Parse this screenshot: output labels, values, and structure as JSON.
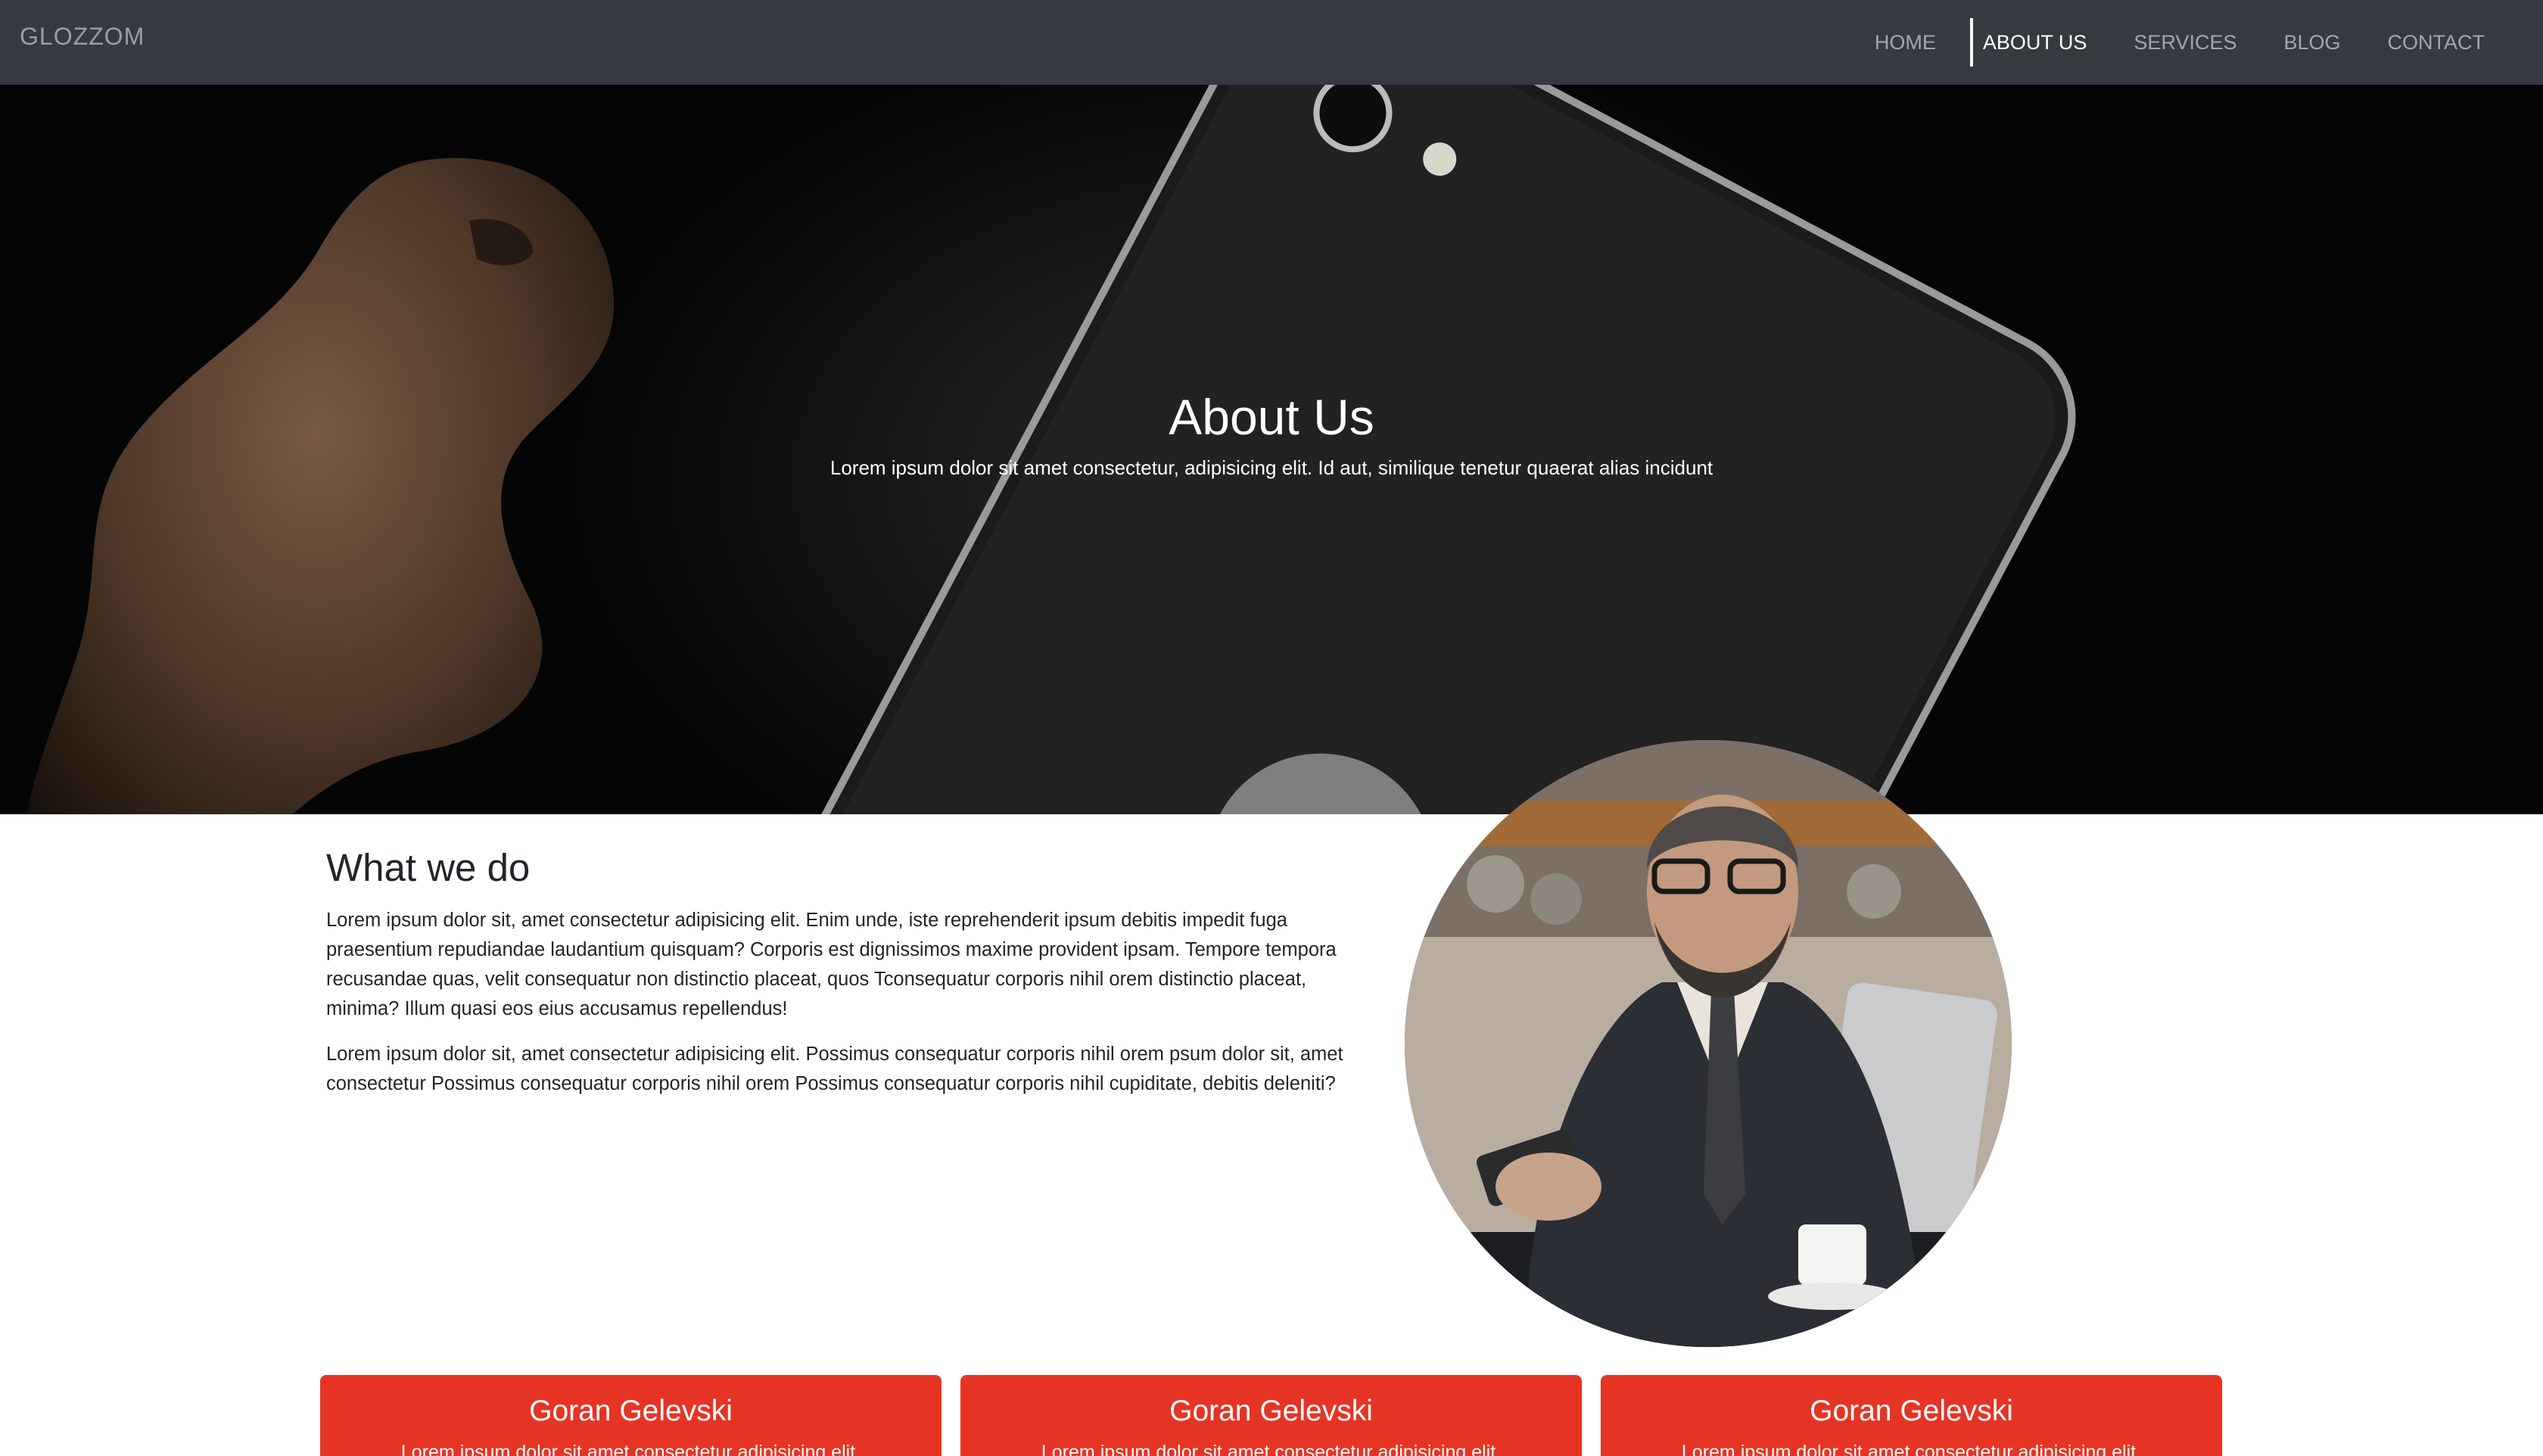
{
  "navbar": {
    "brand": "GLOZZOM",
    "links": [
      {
        "label": "HOME"
      },
      {
        "label": "ABOUT US",
        "active": true
      },
      {
        "label": "SERVICES"
      },
      {
        "label": "BLOG"
      },
      {
        "label": "CONTACT"
      }
    ]
  },
  "hero": {
    "title": "About Us",
    "subtitle": "Lorem ipsum dolor sit amet consectetur, adipisicing elit. Id aut, similique tenetur quaerat alias incidunt"
  },
  "about": {
    "title": "What we do",
    "paragraphs": [
      "Lorem ipsum dolor sit, amet consectetur adipisicing elit. Enim unde, iste reprehenderit ipsum debitis impedit fuga praesentium repudiandae laudantium quisquam? Corporis est dignissimos maxime provident ipsam. Tempore tempora recusandae quas, velit consequatur non distinctio placeat, quos Tconsequatur corporis nihil orem distinctio placeat, minima? Illum quasi eos eius accusamus repellendus!",
      "Lorem ipsum dolor sit, amet consectetur adipisicing elit. Possimus consequatur corporis nihil orem psum dolor sit, amet consectetur Possimus consequatur corporis nihil orem Possimus consequatur corporis nihil cupiditate, debitis deleniti?"
    ]
  },
  "cards": [
    {
      "title": "Goran Gelevski",
      "text": "Lorem ipsum dolor sit amet consectetur adipisicing elit."
    },
    {
      "title": "Goran Gelevski",
      "text": "Lorem ipsum dolor sit amet consectetur adipisicing elit."
    },
    {
      "title": "Goran Gelevski",
      "text": "Lorem ipsum dolor sit amet consectetur adipisicing elit."
    }
  ],
  "colors": {
    "navbar_bg": "#343a40",
    "card_accent": "#e53424",
    "text_dark": "#212529"
  }
}
